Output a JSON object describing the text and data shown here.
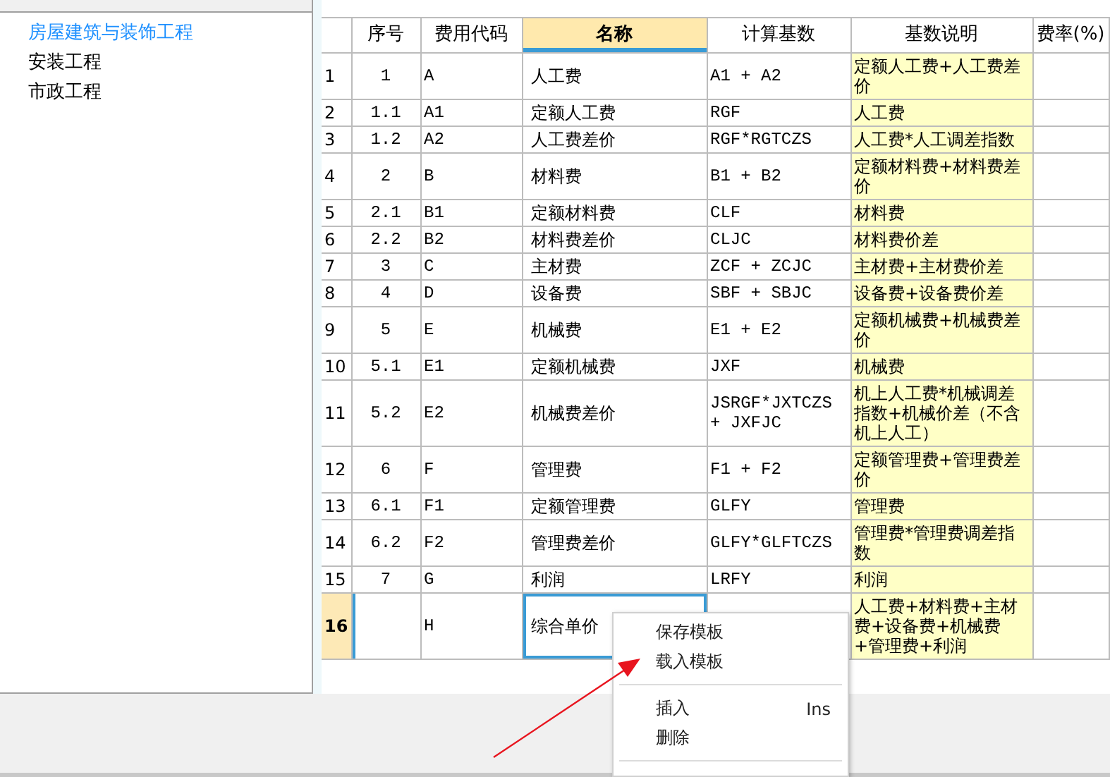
{
  "sidebar": {
    "items": [
      {
        "label": "房屋建筑与装饰工程",
        "selected": true
      },
      {
        "label": "安装工程",
        "selected": false
      },
      {
        "label": "市政工程",
        "selected": false
      }
    ]
  },
  "table": {
    "columns": [
      {
        "label": "序号",
        "selected": false
      },
      {
        "label": "费用代码",
        "selected": false
      },
      {
        "label": "名称",
        "selected": true
      },
      {
        "label": "计算基数",
        "selected": false
      },
      {
        "label": "基数说明",
        "selected": false
      },
      {
        "label": "费率(%)",
        "selected": false
      }
    ],
    "rows": [
      {
        "row_number": "1",
        "selected": false,
        "cells": [
          "1",
          "A",
          "人工费",
          "A1 + A2",
          "定额人工费+人工费差价",
          ""
        ]
      },
      {
        "row_number": "2",
        "selected": false,
        "cells": [
          "1.1",
          "A1",
          "定额人工费",
          "RGF",
          "人工费",
          ""
        ]
      },
      {
        "row_number": "3",
        "selected": false,
        "cells": [
          "1.2",
          "A2",
          "人工费差价",
          "RGF*RGTCZS",
          "人工费*人工调差指数",
          ""
        ]
      },
      {
        "row_number": "4",
        "selected": false,
        "cells": [
          "2",
          "B",
          "材料费",
          "B1 + B2",
          "定额材料费+材料费差价",
          ""
        ]
      },
      {
        "row_number": "5",
        "selected": false,
        "cells": [
          "2.1",
          "B1",
          "定额材料费",
          "CLF",
          "材料费",
          ""
        ]
      },
      {
        "row_number": "6",
        "selected": false,
        "cells": [
          "2.2",
          "B2",
          "材料费差价",
          "CLJC",
          "材料费价差",
          ""
        ]
      },
      {
        "row_number": "7",
        "selected": false,
        "cells": [
          "3",
          "C",
          "主材费",
          "ZCF + ZCJC",
          "主材费+主材费价差",
          ""
        ]
      },
      {
        "row_number": "8",
        "selected": false,
        "cells": [
          "4",
          "D",
          "设备费",
          "SBF + SBJC",
          "设备费+设备费价差",
          ""
        ]
      },
      {
        "row_number": "9",
        "selected": false,
        "cells": [
          "5",
          "E",
          "机械费",
          "E1 + E2",
          "定额机械费+机械费差价",
          ""
        ]
      },
      {
        "row_number": "10",
        "selected": false,
        "cells": [
          "5.1",
          "E1",
          "定额机械费",
          "JXF",
          "机械费",
          ""
        ]
      },
      {
        "row_number": "11",
        "selected": false,
        "cells": [
          "5.2",
          "E2",
          "机械费差价",
          "JSRGF*JXTCZS + JXFJC",
          "机上人工费*机械调差指数+机械价差（不含机上人工）",
          ""
        ]
      },
      {
        "row_number": "12",
        "selected": false,
        "cells": [
          "6",
          "F",
          "管理费",
          "F1 + F2",
          "定额管理费+管理费差价",
          ""
        ]
      },
      {
        "row_number": "13",
        "selected": false,
        "cells": [
          "6.1",
          "F1",
          "定额管理费",
          "GLFY",
          "管理费",
          ""
        ]
      },
      {
        "row_number": "14",
        "selected": false,
        "cells": [
          "6.2",
          "F2",
          "管理费差价",
          "GLFY*GLFTCZS",
          "管理费*管理费调差指数",
          ""
        ]
      },
      {
        "row_number": "15",
        "selected": false,
        "cells": [
          "7",
          "G",
          "利润",
          "LRFY",
          "利润",
          ""
        ]
      },
      {
        "row_number": "16",
        "selected": true,
        "cells": [
          "",
          "H",
          "综合单价",
          "",
          "人工费+材料费+主材费+设备费+机械费+管理费+利润",
          ""
        ]
      }
    ]
  },
  "context_menu": {
    "items": [
      {
        "kind": "item",
        "label": "保存模板"
      },
      {
        "kind": "item",
        "label": "载入模板"
      },
      {
        "kind": "separator"
      },
      {
        "kind": "item",
        "label": "插入",
        "shortcut": "Ins"
      },
      {
        "kind": "item",
        "label": "删除"
      },
      {
        "kind": "separator"
      }
    ]
  }
}
